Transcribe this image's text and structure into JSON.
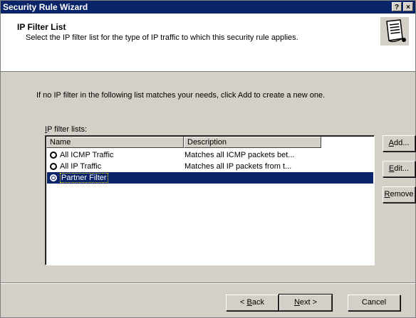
{
  "window": {
    "title": "Security Rule Wizard",
    "help_glyph": "?",
    "close_glyph": "×"
  },
  "header": {
    "title": "IP Filter List",
    "subtitle": "Select the IP filter list for the type of IP traffic to which this security rule applies.",
    "icon": "document-scroll-icon"
  },
  "body": {
    "intro": "If no IP filter in the following list matches your needs, click Add to create a new one.",
    "list_label_hotkey": "I",
    "list_label_rest": "P filter lists:"
  },
  "listview": {
    "columns": [
      "Name",
      "Description"
    ],
    "rows": [
      {
        "name": "All ICMP Traffic",
        "description": "Matches all ICMP packets bet...",
        "checked": false,
        "selected": false
      },
      {
        "name": "All IP Traffic",
        "description": "Matches all IP packets from t...",
        "checked": false,
        "selected": false
      },
      {
        "name": "Partner Filter",
        "description": "",
        "checked": true,
        "selected": true
      }
    ]
  },
  "side_buttons": {
    "add": {
      "hotkey": "A",
      "rest": "dd..."
    },
    "edit": {
      "hotkey": "E",
      "rest": "dit..."
    },
    "remove": {
      "hotkey": "R",
      "rest": "emove"
    }
  },
  "footer": {
    "back": {
      "prefix": "< ",
      "hotkey": "B",
      "rest": "ack"
    },
    "next": {
      "hotkey": "N",
      "rest": "ext >"
    },
    "cancel": "Cancel"
  },
  "colors": {
    "titlebar": "#0a246a",
    "face": "#d4d0c8",
    "selection": "#0a246a"
  }
}
